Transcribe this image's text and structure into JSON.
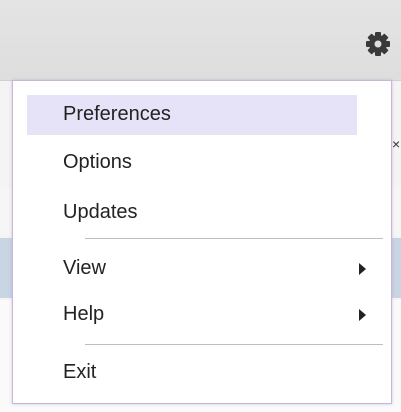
{
  "colors": {
    "menu_highlight": "#e6e2f7",
    "menu_border": "#c9b7d9",
    "toolbar_bg": "#dedede",
    "selected_row_bg": "#c7d6e2"
  },
  "toolbar": {
    "settings_icon": "gear-icon"
  },
  "background": {
    "close_glyph": "×"
  },
  "menu": {
    "items": [
      {
        "label": "Preferences",
        "highlighted": true
      },
      {
        "label": "Options"
      },
      {
        "label": "Updates"
      },
      {
        "label": "View",
        "has_submenu": true
      },
      {
        "label": "Help",
        "has_submenu": true
      },
      {
        "label": "Exit"
      }
    ]
  }
}
